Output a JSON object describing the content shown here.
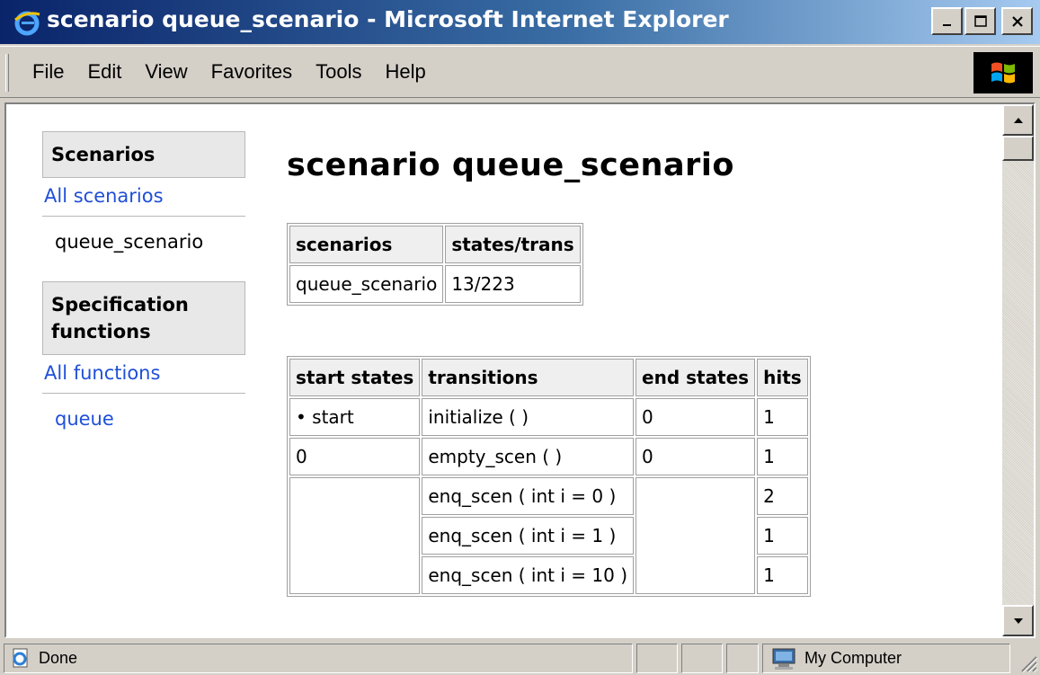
{
  "window": {
    "title": "scenario queue_scenario - Microsoft Internet Explorer",
    "buttons": [
      "minimize-icon",
      "maximize-icon",
      "close-icon"
    ]
  },
  "menu": {
    "items": [
      "File",
      "Edit",
      "View",
      "Favorites",
      "Tools",
      "Help"
    ]
  },
  "sidebar": {
    "scenarios_heading": "Scenarios",
    "all_scenarios_link": "All scenarios",
    "current_scenario": "queue_scenario",
    "functions_heading": "Specification functions",
    "all_functions_link": "All functions",
    "function_link": "queue"
  },
  "page": {
    "title": "scenario queue_scenario"
  },
  "summary_table": {
    "headers": [
      "scenarios",
      "states/trans"
    ],
    "rows": [
      [
        "queue_scenario",
        "13/223"
      ]
    ]
  },
  "transitions_table": {
    "headers": [
      "start states",
      "transitions",
      "end states",
      "hits"
    ],
    "rows": [
      {
        "start": "• start",
        "transition": "initialize ( )",
        "end": "0",
        "hits": "1"
      },
      {
        "start": "0",
        "transition": "empty_scen ( )",
        "end": "0",
        "hits": "1"
      },
      {
        "start": "",
        "transition": "enq_scen ( int i = 0 )",
        "end": "",
        "hits": "2"
      },
      {
        "start": "",
        "transition": "enq_scen ( int i = 1 )",
        "end": "",
        "hits": "1"
      },
      {
        "start": "",
        "transition": "enq_scen ( int i = 10 )",
        "end": "",
        "hits": "1"
      }
    ]
  },
  "status": {
    "text": "Done",
    "zone": "My Computer"
  },
  "colors": {
    "link": "#1f4fd8",
    "titlebar_start": "#0a246a",
    "titlebar_end": "#a6caf0"
  }
}
